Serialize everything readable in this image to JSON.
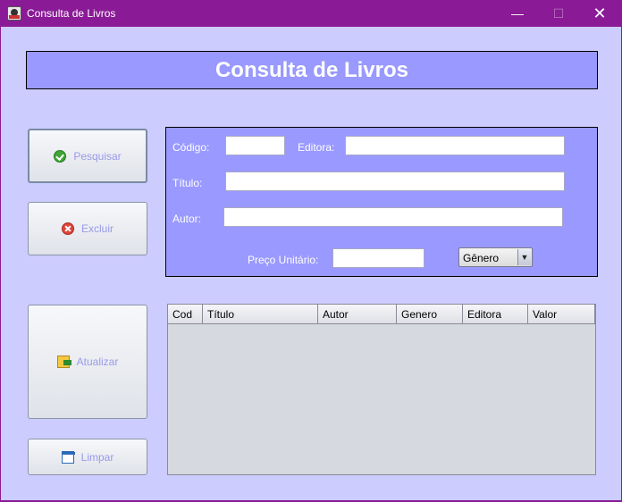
{
  "window": {
    "title": "Consulta de Livros",
    "minimize": "—",
    "maximize": "☐",
    "close": "✕"
  },
  "header": {
    "title": "Consulta de Livros"
  },
  "buttons": {
    "pesquisar": "Pesquisar",
    "excluir": "Excluir",
    "atualizar": "Atualizar",
    "limpar": "Limpar"
  },
  "form": {
    "codigo_label": "Código:",
    "editora_label": "Editora:",
    "titulo_label": "Título:",
    "autor_label": "Autor:",
    "preco_label": "Preço Unitário:",
    "genero_selected": "Gênero",
    "genero_arrow": "▼"
  },
  "table": {
    "columns": [
      "Cod",
      "Título",
      "Autor",
      "Genero",
      "Editora",
      "Valor"
    ]
  }
}
